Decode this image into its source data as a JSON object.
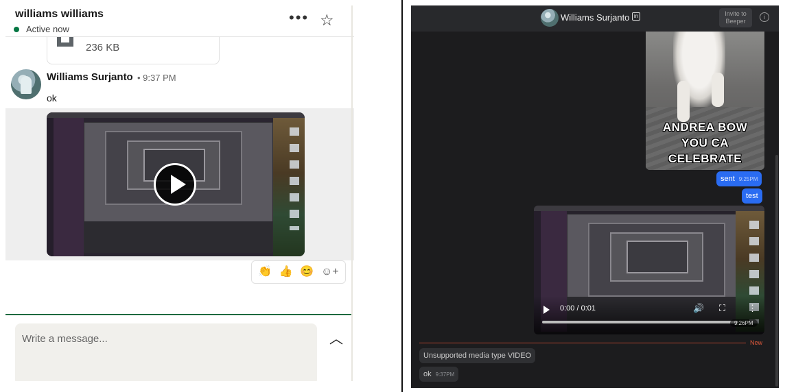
{
  "left": {
    "contact_name": "williams williams",
    "status": "Active now",
    "more_icon": "ellipsis-icon",
    "star_icon": "star-icon",
    "file": {
      "size": "236 KB"
    },
    "message": {
      "sender": "Williams Surjanto",
      "time": "9:37 PM",
      "text": "ok"
    },
    "reactions": [
      "👏",
      "👍",
      "😊",
      "☺+"
    ],
    "composer": {
      "placeholder": "Write a message..."
    },
    "accent_color": "#057642"
  },
  "right": {
    "title": "Williams Surjanto",
    "linkedin_badge": "in",
    "invite_button": "Invite to Beeper",
    "info_icon": "info-icon",
    "gif_caption": "ANDREA BOW\nYOU CA\nCELEBRATE",
    "outgoing": [
      {
        "text": "sent",
        "time": "9:25PM"
      },
      {
        "text": "test",
        "time": ""
      }
    ],
    "video": {
      "time": "0:00 / 0:01",
      "stamp": "9:26PM"
    },
    "new_label": "New",
    "incoming": [
      {
        "text": "Unsupported media type VIDEO",
        "time": ""
      },
      {
        "text": "ok",
        "time": "9:37PM"
      }
    ],
    "accent_color": "#2a6cf2"
  }
}
